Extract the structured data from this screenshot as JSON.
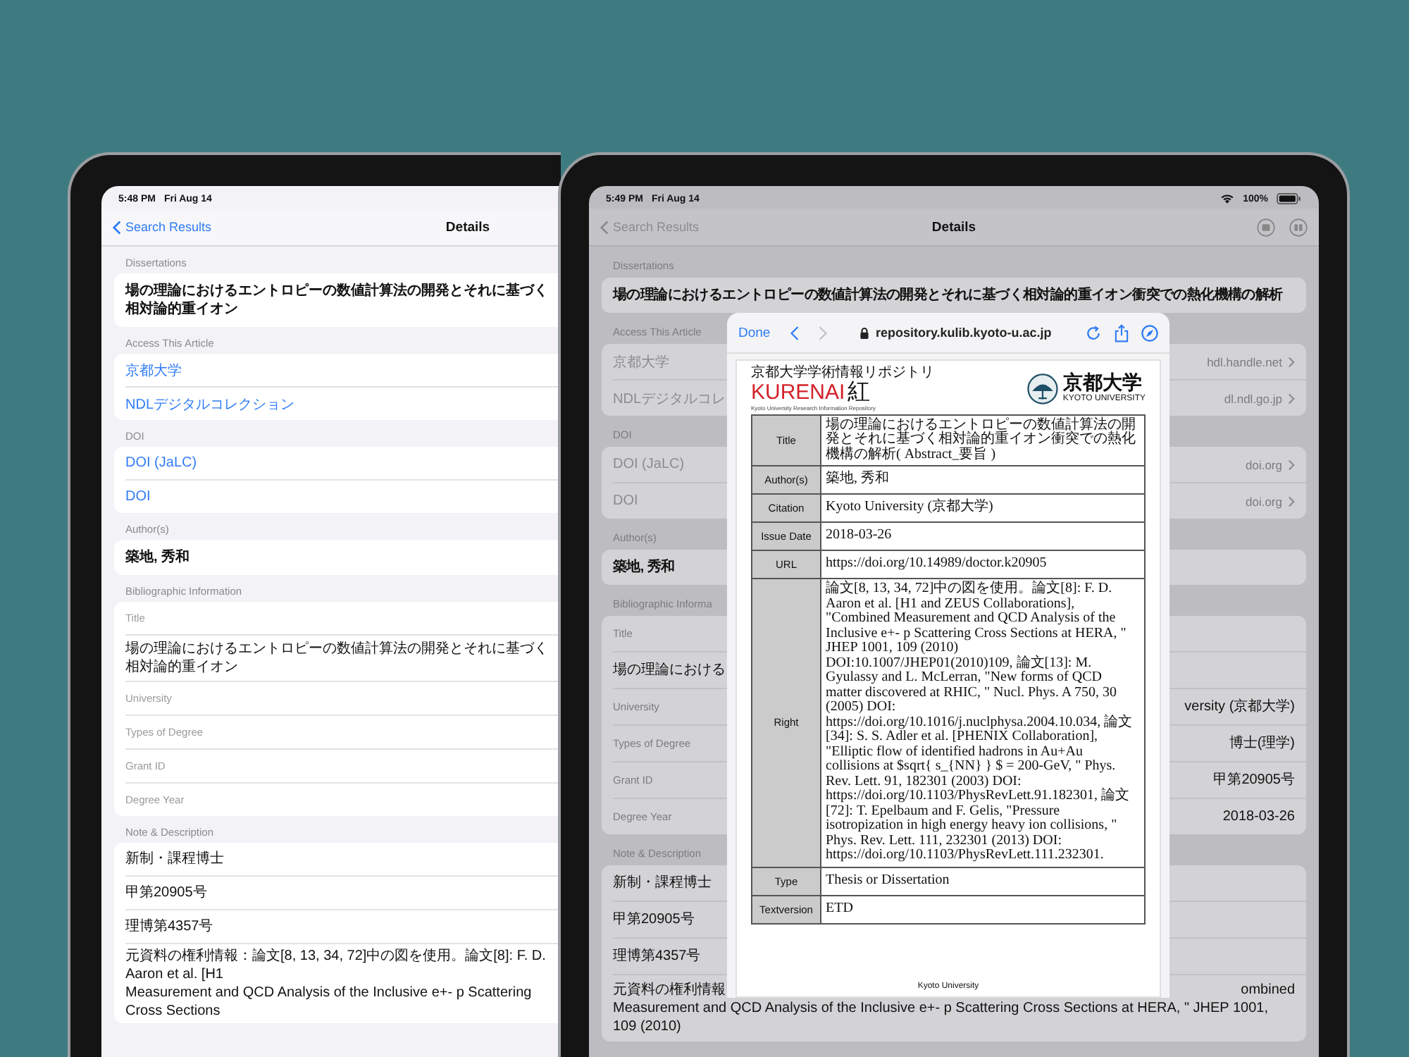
{
  "devices": [
    {
      "dimmed": false,
      "status_bar": {
        "time": "5:48 PM",
        "date": "Fri Aug 14"
      },
      "nav": {
        "back": "Search Results",
        "title": "Details"
      },
      "sections": [
        {
          "header": "Dissertations",
          "rows": [
            {
              "kind": "title",
              "text": "場の理論におけるエントロピーの数値計算法の開発とそれに基づく相対論的重イオン"
            }
          ]
        },
        {
          "header": "Access This Article",
          "rows": [
            {
              "kind": "link",
              "text": "京都大学"
            },
            {
              "kind": "link",
              "text": "NDLデジタルコレクション"
            }
          ]
        },
        {
          "header": "DOI",
          "rows": [
            {
              "kind": "link",
              "text": "DOI (JaLC)"
            },
            {
              "kind": "link",
              "text": "DOI"
            }
          ]
        },
        {
          "header": "Author(s)",
          "rows": [
            {
              "kind": "title",
              "text": "築地, 秀和"
            }
          ]
        },
        {
          "header": "Bibliographic Information",
          "rows": [
            {
              "kind": "label",
              "text": "Title"
            },
            {
              "kind": "value",
              "text": "場の理論におけるエントロピーの数値計算法の開発とそれに基づく相対論的重イオン"
            },
            {
              "kind": "label",
              "text": "University"
            },
            {
              "kind": "label",
              "text": "Types of Degree"
            },
            {
              "kind": "label",
              "text": "Grant ID"
            },
            {
              "kind": "label",
              "text": "Degree Year"
            }
          ]
        },
        {
          "header": "Note & Description",
          "rows": [
            {
              "kind": "value",
              "text": "新制・課程博士"
            },
            {
              "kind": "value",
              "text": "甲第20905号"
            },
            {
              "kind": "value",
              "text": "理博第4357号"
            },
            {
              "kind": "paragraph",
              "lines": [
                [
                  "元資料の権利情報：論文[8, 13, 34, 72]中の図を使用。論文[8]: F. D. Aaron et al. [H1"
                ],
                [
                  "Measurement and QCD Analysis of the Inclusive e+- p Scattering Cross Sections"
                ]
              ]
            }
          ]
        }
      ]
    },
    {
      "dimmed": true,
      "status_bar": {
        "time": "5:49 PM",
        "date": "Fri Aug 14",
        "battery": "100%"
      },
      "nav": {
        "back": "Search Results",
        "title": "Details"
      },
      "sections": [
        {
          "header": "Dissertations",
          "rows": [
            {
              "kind": "title",
              "text": "場の理論におけるエントロピーの数値計算法の開発とそれに基づく相対論的重イオン衝突での熱化機構の解析"
            }
          ]
        },
        {
          "header": "Access This Article",
          "rows": [
            {
              "kind": "link",
              "text": "京都大学",
              "detail": "hdl.handle.net"
            },
            {
              "kind": "link",
              "text": "NDLデジタルコレ",
              "detail": "dl.ndl.go.jp"
            }
          ]
        },
        {
          "header": "DOI",
          "rows": [
            {
              "kind": "link",
              "text": "DOI (JaLC)",
              "detail": "doi.org"
            },
            {
              "kind": "link",
              "text": "DOI",
              "detail": "doi.org"
            }
          ]
        },
        {
          "header": "Author(s)",
          "rows": [
            {
              "kind": "title",
              "text": "築地, 秀和"
            }
          ]
        },
        {
          "header": "Bibliographic Informa",
          "rows": [
            {
              "kind": "label",
              "text": "Title"
            },
            {
              "kind": "value",
              "text": "場の理論における"
            },
            {
              "kind": "label",
              "text": "University",
              "value": "versity (京都大学)"
            },
            {
              "kind": "label",
              "text": "Types of Degree",
              "value": "博士(理学)"
            },
            {
              "kind": "label",
              "text": "Grant ID",
              "value": "甲第20905号"
            },
            {
              "kind": "label",
              "text": "Degree Year",
              "value": "2018-03-26"
            }
          ]
        },
        {
          "header": "Note & Description",
          "rows": [
            {
              "kind": "value",
              "text": "新制・課程博士"
            },
            {
              "kind": "value",
              "text": "甲第20905号"
            },
            {
              "kind": "value",
              "text": "理博第4357号"
            },
            {
              "kind": "paragraph",
              "lines": [
                [
                  "元資料の権利情報",
                  "ombined"
                ],
                [
                  "Measurement and QCD Analysis of the Inclusive e+- p Scattering Cross Sections at HERA, \" JHEP 1001, 109 (2010)"
                ]
              ]
            }
          ]
        }
      ],
      "web_sheet": {
        "done": "Done",
        "back_enabled": true,
        "forward_enabled": false,
        "url": "repository.kulib.kyoto-u.ac.jp",
        "repo_logo": {
          "caption": "京都大学学術情報リポジトリ",
          "name": "KURENAI",
          "kanji": "紅",
          "subtitle": "Kyoto University Research Information Repository"
        },
        "university_logo": {
          "name": "京都大学",
          "subtitle": "KYOTO UNIVERSITY"
        },
        "table": [
          {
            "header": "Title",
            "value": "場の理論におけるエントロピーの数値計算法の開発とそれに基づく相対論的重イオン衝突での熱化機構の解析( Abstract_要旨 )"
          },
          {
            "header": "Author(s)",
            "value": "築地, 秀和"
          },
          {
            "header": "Citation",
            "value": "Kyoto University (京都大学)"
          },
          {
            "header": "Issue Date",
            "value": "2018-03-26"
          },
          {
            "header": "URL",
            "value": "https://doi.org/10.14989/doctor.k20905"
          },
          {
            "header": "Right",
            "value": "論文[8, 13, 34, 72]中の図を使用。論文[8]: F. D. Aaron et al. [H1 and ZEUS Collaborations], \"Combined Measurement and QCD Analysis of the Inclusive e+- p Scattering Cross Sections at HERA, \" JHEP 1001, 109 (2010) DOI:10.1007/JHEP01(2010)109, 論文[13]: M. Gyulassy and L. McLerran, \"New forms of QCD matter discovered at RHIC, \" Nucl. Phys. A 750, 30 (2005) DOI: https://doi.org/10.1016/j.nuclphysa.2004.10.034, 論文[34]: S. S. Adler et al. [PHENIX Collaboration], \"Elliptic flow of identified hadrons in Au+Au collisions at $sqrt{ s_{NN} } $ = 200-GeV, \" Phys. Rev. Lett. 91, 182301 (2003) DOI: https://doi.org/10.1103/PhysRevLett.91.182301, 論文[72]: T. Epelbaum and F. Gelis, \"Pressure isotropization in high energy heavy ion collisions, \" Phys. Rev. Lett. 111, 232301 (2013) DOI: https://doi.org/10.1103/PhysRevLett.111.232301."
          },
          {
            "header": "Type",
            "value": "Thesis or Dissertation"
          },
          {
            "header": "Textversion",
            "value": "ETD"
          }
        ],
        "footer": "Kyoto University"
      }
    }
  ]
}
